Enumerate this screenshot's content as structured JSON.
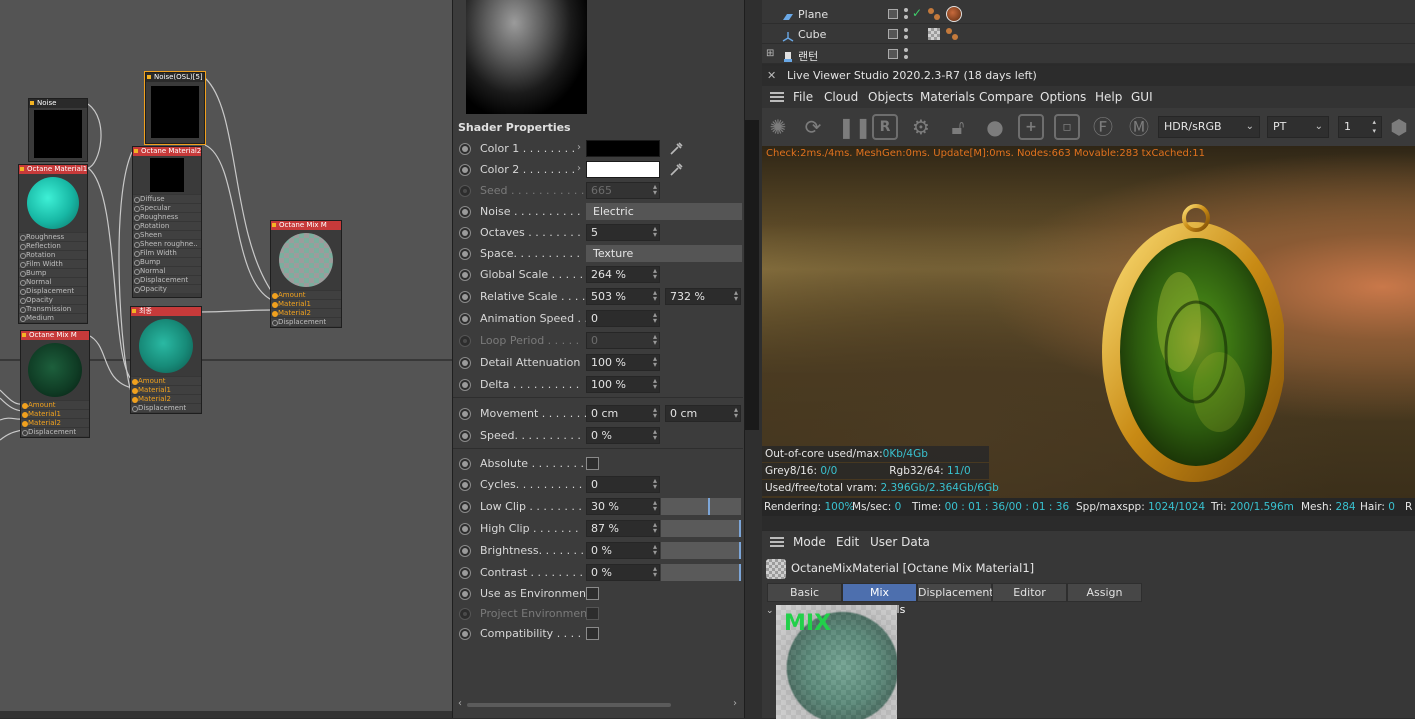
{
  "node_editor": {
    "nodes": {
      "noise": {
        "title": "Noise"
      },
      "noise_osl": {
        "title": "Noise(OSL)[5]"
      },
      "octane_material1": {
        "title": "Octane Material1",
        "ports": [
          "Roughness",
          "Reflection",
          "Rotation",
          "Film Width",
          "Bump",
          "Normal",
          "Displacement",
          "Opacity",
          "Transmission",
          "Medium"
        ]
      },
      "octane_material2": {
        "title": "Octane Material2",
        "ports": [
          "Diffuse",
          "Specular",
          "Roughness",
          "Rotation",
          "Sheen",
          "Sheen roughne..",
          "Film Width",
          "Bump",
          "Normal",
          "Displacement",
          "Opacity"
        ]
      },
      "octane_mix_m_right": {
        "title": "Octane Mix M",
        "ports": [
          "Amount",
          "Material1",
          "Material2",
          "Displacement"
        ]
      },
      "octane_mix_m_left": {
        "title": "Octane Mix M",
        "ports": [
          "Amount",
          "Material1",
          "Material2",
          "Displacement"
        ]
      },
      "final": {
        "title": "최종",
        "ports": [
          "Amount",
          "Material1",
          "Material2",
          "Displacement"
        ]
      }
    }
  },
  "shader": {
    "title": "Shader Properties",
    "color1": {
      "label": "Color 1 . . . . . . . .",
      "value": "#000000"
    },
    "color2": {
      "label": "Color 2 . . . . . . . .",
      "value": "#ffffff"
    },
    "seed": {
      "label": "Seed . . . . . . . . . . .",
      "value": "665"
    },
    "noise": {
      "label": "Noise . . . . . . . . . .",
      "value": "Electric"
    },
    "octaves": {
      "label": "Octaves . . . . . . . .",
      "value": "5"
    },
    "space": {
      "label": "Space. . . . . . . . . .",
      "value": "Texture"
    },
    "global_scale": {
      "label": "Global Scale . . . . .",
      "value": "264 %"
    },
    "relative_scale": {
      "label": "Relative Scale . . . .",
      "value": "503 %",
      "value2": "732 %"
    },
    "animation_speed": {
      "label": "Animation Speed . .",
      "value": "0"
    },
    "loop_period": {
      "label": "Loop Period . . . . .",
      "value": "0"
    },
    "detail_attenuation": {
      "label": "Detail Attenuation",
      "value": "100 %"
    },
    "delta": {
      "label": "Delta . . . . . . . . . .",
      "value": "100 %"
    },
    "movement": {
      "label": "Movement . . . . . . .",
      "value": "0 cm",
      "value2": "0 cm"
    },
    "speed": {
      "label": "Speed. . . . . . . . . .",
      "value": "0 %"
    },
    "absolute": {
      "label": "Absolute . . . . . . . ."
    },
    "cycles": {
      "label": "Cycles. . . . . . . . . .",
      "value": "0"
    },
    "low_clip": {
      "label": "Low Clip . . . . . . . .",
      "value": "30 %",
      "fraction": 0.6
    },
    "high_clip": {
      "label": "High Clip . . . . . . .",
      "value": "87 %",
      "fraction": 1.0
    },
    "brightness": {
      "label": "Brightness. . . . . . .",
      "value": "0 %",
      "fraction": 1.0
    },
    "contrast": {
      "label": "Contrast . . . . . . . .",
      "value": "0 %",
      "fraction": 1.0
    },
    "use_as_environment": {
      "label": "Use as Environment"
    },
    "project_environment": {
      "label": "Project Environment"
    },
    "compatibility": {
      "label": "Compatibility . . . ."
    }
  },
  "object_manager": {
    "objects": [
      {
        "name": "Plane"
      },
      {
        "name": "Cube"
      },
      {
        "name": "랜턴"
      }
    ]
  },
  "live_viewer": {
    "title": "Live Viewer Studio 2020.2.3-R7 (18 days left)",
    "menu": [
      "File",
      "Cloud",
      "Objects",
      "Materials",
      "Compare",
      "Options",
      "Help",
      "GUI"
    ],
    "color_space": "HDR/sRGB",
    "kernel": "PT",
    "value_field": "1",
    "status_line": "Check:2ms./4ms. MeshGen:0ms. Update[M]:0ms. Nodes:663 Movable:283 txCached:11",
    "stats": {
      "out_of_core_label": "Out-of-core used/max:",
      "out_of_core_value": "0Kb/4Gb",
      "grey_label": "Grey8/16:",
      "grey_value": "0/0",
      "rgb_label": "Rgb32/64:",
      "rgb_value": "11/0",
      "vram_label": "Used/free/total vram:",
      "vram_value": "2.396Gb/2.364Gb/6Gb"
    },
    "bottom": {
      "rendering_label": "Rendering:",
      "rendering_value": "100%",
      "ms_label": "Ms/sec:",
      "ms_value": "0",
      "time_label": "Time:",
      "time_value": "00 : 01 : 36/00 : 01 : 36",
      "spp_label": "Spp/maxspp:",
      "spp_value": "1024/1024",
      "tri_label": "Tri:",
      "tri_value": "200/1.596m",
      "mesh_label": "Mesh:",
      "mesh_value": "284",
      "hair_label": "Hair:",
      "hair_value": "0",
      "rt_label": "R"
    }
  },
  "attributes": {
    "menu": [
      "Mode",
      "Edit",
      "User Data"
    ],
    "object_title": "OctaneMixMaterial [Octane Mix Material1]",
    "tabs": [
      "Basic",
      "Mix materials",
      "Displacement",
      "Editor",
      "Assign"
    ],
    "active_tab": "Mix materials",
    "preview_label": "MIX"
  }
}
